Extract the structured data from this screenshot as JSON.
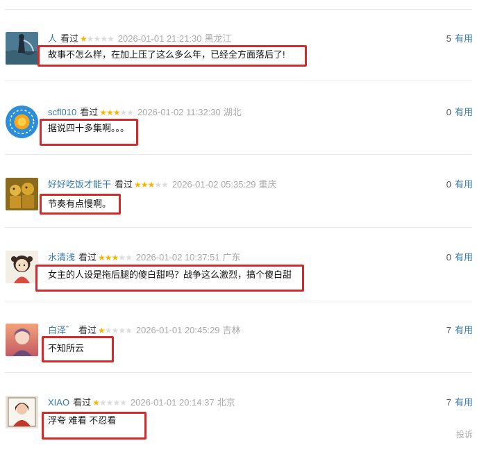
{
  "comments": [
    {
      "user": "人",
      "status": "看过",
      "rating": 1,
      "time": "2026-01-01 21:21:30",
      "location": "黑龙江",
      "votes": "5",
      "useful_label": "有用",
      "text": "故事不怎么样，在加上压了这么多么年，已经全方面落后了!",
      "avatar": "avatar-landscape"
    },
    {
      "user": "scfl010",
      "status": "看过",
      "rating": 3,
      "time": "2026-01-02 11:32:30",
      "location": "湖北",
      "votes": "0",
      "useful_label": "有用",
      "text": "据说四十多集啊。。。",
      "avatar": "avatar-sun-disc"
    },
    {
      "user": "好好吃饭才能干",
      "status": "看过",
      "rating": 3,
      "time": "2026-01-02 05:35:29",
      "location": "重庆",
      "votes": "0",
      "useful_label": "有用",
      "text": "节奏有点慢啊。",
      "avatar": "avatar-golden-figures"
    },
    {
      "user": "水清浅",
      "status": "看过",
      "rating": 3,
      "time": "2026-01-02 10:37:51",
      "location": "广东",
      "votes": "0",
      "useful_label": "有用",
      "text": "女主的人设是拖后腿的傻白甜吗？战争这么激烈，搞个傻白甜",
      "avatar": "avatar-cartoon-girl"
    },
    {
      "user": "白泽゛",
      "status": "看过",
      "rating": 1,
      "time": "2026-01-01 20:45:29",
      "location": "吉林",
      "votes": "7",
      "useful_label": "有用",
      "text": "不知所云",
      "avatar": "avatar-anime-sunset"
    },
    {
      "user": "XIAO",
      "status": "看过",
      "rating": 1,
      "time": "2026-01-01 20:14:37",
      "location": "北京",
      "votes": "7",
      "useful_label": "有用",
      "text": "浮夸 难看 不忍看",
      "avatar": "avatar-portrait"
    }
  ],
  "footer": {
    "report_label": "投诉"
  },
  "colors": {
    "link": "#3377aa",
    "highlight_box": "#d42a2a",
    "star": "#f7b500"
  }
}
